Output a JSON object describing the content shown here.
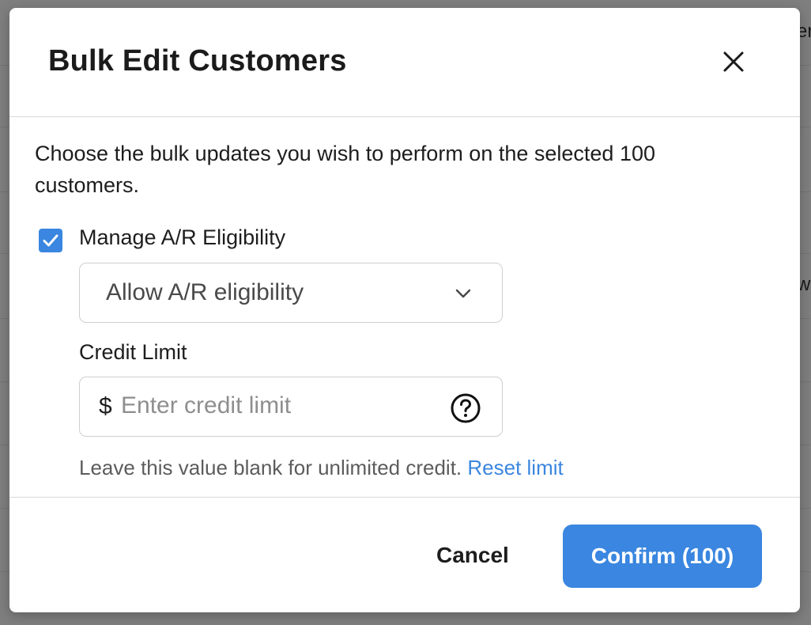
{
  "background": {
    "fragments": [
      "er",
      "w"
    ]
  },
  "modal": {
    "title": "Bulk Edit Customers",
    "close_icon": "close-icon",
    "description": "Choose the bulk updates you wish to perform on the selected 100 customers.",
    "ar_eligibility": {
      "checked": true,
      "label": "Manage A/R Eligibility",
      "select_value": "Allow A/R eligibility",
      "chevron_icon": "chevron-down-icon"
    },
    "credit_limit": {
      "label": "Credit Limit",
      "currency_symbol": "$",
      "value": "",
      "placeholder": "Enter credit limit",
      "help_icon": "question-circle-icon",
      "hint": "Leave this value blank for unlimited credit.",
      "reset_link": "Reset limit"
    },
    "footer": {
      "cancel_label": "Cancel",
      "confirm_label": "Confirm (100)"
    }
  },
  "colors": {
    "accent": "#3a86e0",
    "overlay": "#7f7f7f",
    "border": "#cfcfcf"
  }
}
